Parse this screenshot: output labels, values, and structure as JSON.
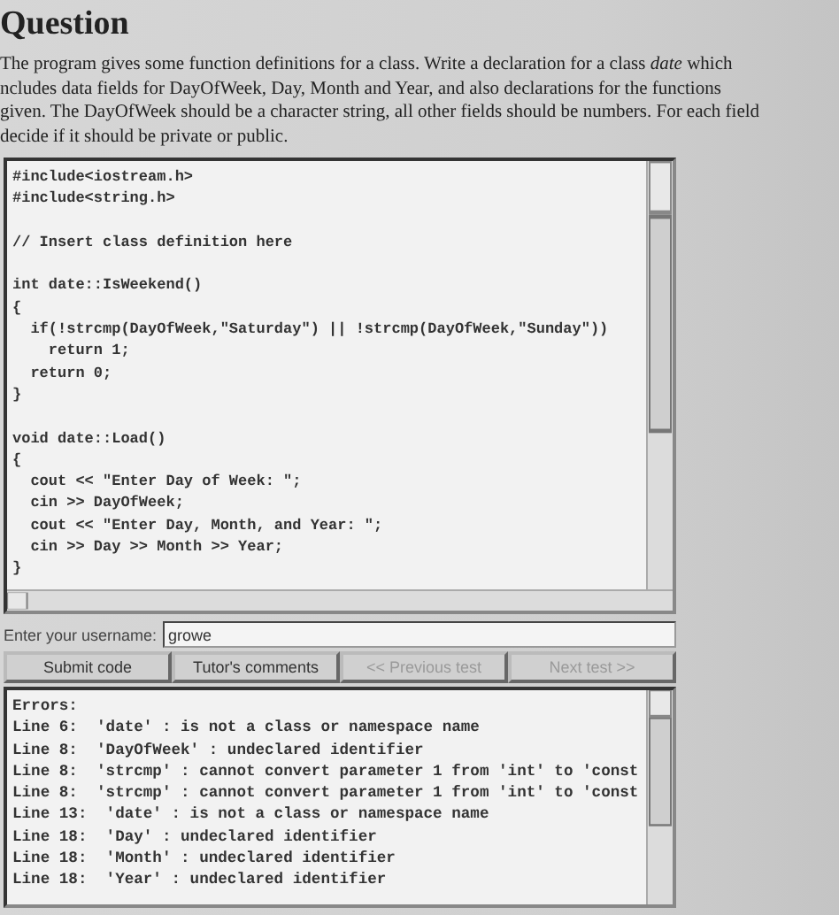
{
  "heading": "Question",
  "paragraph_lines": [
    "The program gives some function definitions for a class. Write a declaration for a class *date* which",
    "ncludes data fields for DayOfWeek, Day, Month and Year, and also declarations for the functions",
    "given. The DayOfWeek should be a character string, all other fields should be numbers. For each field",
    "decide if it should be private or public."
  ],
  "code_blocks": [
    [
      "#include<iostream.h>",
      "#include<string.h>"
    ],
    [
      "// Insert class definition here"
    ],
    [
      "int date::IsWeekend()",
      "{",
      "  if(!strcmp(DayOfWeek,\"Saturday\") || !strcmp(DayOfWeek,\"Sunday\"))",
      "    return 1;",
      "  return 0;",
      "}"
    ],
    [
      "void date::Load()",
      "{",
      "  cout << \"Enter Day of Week: \";",
      "  cin >> DayOfWeek;",
      "  cout << \"Enter Day, Month, and Year: \";",
      "  cin >> Day >> Month >> Year;",
      "}"
    ]
  ],
  "username": {
    "label": "Enter your username:",
    "value": "growe"
  },
  "buttons": [
    {
      "label": "Submit code",
      "disabled": false
    },
    {
      "label": "Tutor's comments",
      "disabled": false
    },
    {
      "label": "<< Previous test",
      "disabled": true
    },
    {
      "label": "Next test >>",
      "disabled": true
    }
  ],
  "error_lines": [
    "Errors:",
    "Line 6:  'date' : is not a class or namespace name",
    "Line 8:  'DayOfWeek' : undeclared identifier",
    "Line 8:  'strcmp' : cannot convert parameter 1 from 'int' to 'const",
    "Line 8:  'strcmp' : cannot convert parameter 1 from 'int' to 'const",
    "Line 13:  'date' : is not a class or namespace name",
    "Line 18:  'Day' : undeclared identifier",
    "Line 18:  'Month' : undeclared identifier",
    "Line 18:  'Year' : undeclared identifier"
  ]
}
